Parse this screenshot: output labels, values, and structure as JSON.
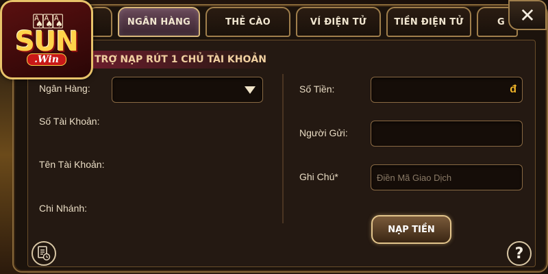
{
  "logo": {
    "text": "SUN",
    "sub": ".Win",
    "cards": "🂡🂡🂡"
  },
  "tabs": [
    {
      "label": ""
    },
    {
      "label": "NGÂN HÀNG",
      "active": true
    },
    {
      "label": "THẺ CÀO"
    },
    {
      "label": "VÍ ĐIỆN TỬ"
    },
    {
      "label": "TIỀN ĐIỆN TỬ"
    },
    {
      "label": "G"
    }
  ],
  "close": {
    "symbol": "✕"
  },
  "banner": {
    "text": "TRỢ NẠP RÚT 1 CHỦ TÀI KHOẢN"
  },
  "left": {
    "bank_label": "Ngân Hàng:",
    "account_number_label": "Số Tài Khoản:",
    "account_name_label": "Tên Tài Khoản:",
    "branch_label": "Chi Nhánh:"
  },
  "right": {
    "amount_label": "Số Tiền:",
    "amount_currency": "đ",
    "sender_label": "Người Gửi:",
    "note_label": "Ghi Chú*",
    "note_placeholder": "Điền Mã Giao Dịch"
  },
  "buttons": {
    "deposit": "NẠP TIỀN",
    "help": "?"
  },
  "icons": {
    "history": "history-icon",
    "help": "help-icon",
    "close": "close-icon",
    "dropdown": "chevron-down-icon"
  },
  "colors": {
    "accent": "#e3c58c",
    "currency": "#f0b429",
    "banner": "#6a1c2c"
  }
}
